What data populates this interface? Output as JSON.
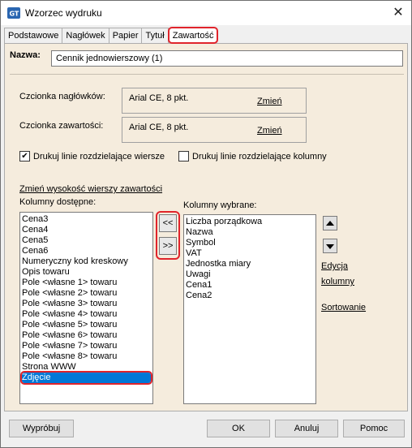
{
  "window": {
    "title": "Wzorzec wydruku",
    "close": "✕"
  },
  "tabs": [
    "Podstawowe",
    "Nagłówek",
    "Papier",
    "Tytuł",
    "Zawartość"
  ],
  "name": {
    "label": "Nazwa:",
    "value": "Cennik jednowierszowy (1)"
  },
  "fonts": {
    "header_label": "Czcionka nagłówków:",
    "header_value": "Arial CE, 8 pkt.",
    "content_label": "Czcionka zawartości:",
    "content_value": "Arial CE, 8 pkt.",
    "change_link": "Zmień"
  },
  "checks": {
    "rows_label": "Drukuj linie rozdzielające wiersze",
    "rows_checked": true,
    "cols_label": "Drukuj linie rozdzielające kolumny",
    "cols_checked": false
  },
  "row_height_link": "Zmień wysokość wierszy zawartości",
  "available": {
    "label": "Kolumny dostępne:",
    "items": [
      "Cena3",
      "Cena4",
      "Cena5",
      "Cena6",
      "Numeryczny kod kreskowy",
      "Opis towaru",
      "Pole <własne 1> towaru",
      "Pole <własne 2> towaru",
      "Pole <własne 3> towaru",
      "Pole <własne 4> towaru",
      "Pole <własne 5> towaru",
      "Pole <własne 6> towaru",
      "Pole <własne 7> towaru",
      "Pole <własne 8> towaru",
      "Strona WWW",
      "Zdjęcie"
    ],
    "selected_index": 15
  },
  "move": {
    "left": "<<",
    "right": ">>"
  },
  "chosen": {
    "label": "Kolumny wybrane:",
    "items": [
      "Liczba porządkowa",
      "Nazwa",
      "Symbol",
      "VAT",
      "Jednostka miary",
      "Uwagi",
      "Cena1",
      "Cena2"
    ]
  },
  "side_links": {
    "edit_1": "Edycja",
    "edit_2": "kolumny",
    "sort": "Sortowanie"
  },
  "buttons": {
    "try": "Wypróbuj",
    "ok": "OK",
    "cancel": "Anuluj",
    "help": "Pomoc"
  },
  "colors": {
    "highlight": "#e0242b",
    "selection": "#0078d7",
    "panel": "#f5ecdd"
  }
}
